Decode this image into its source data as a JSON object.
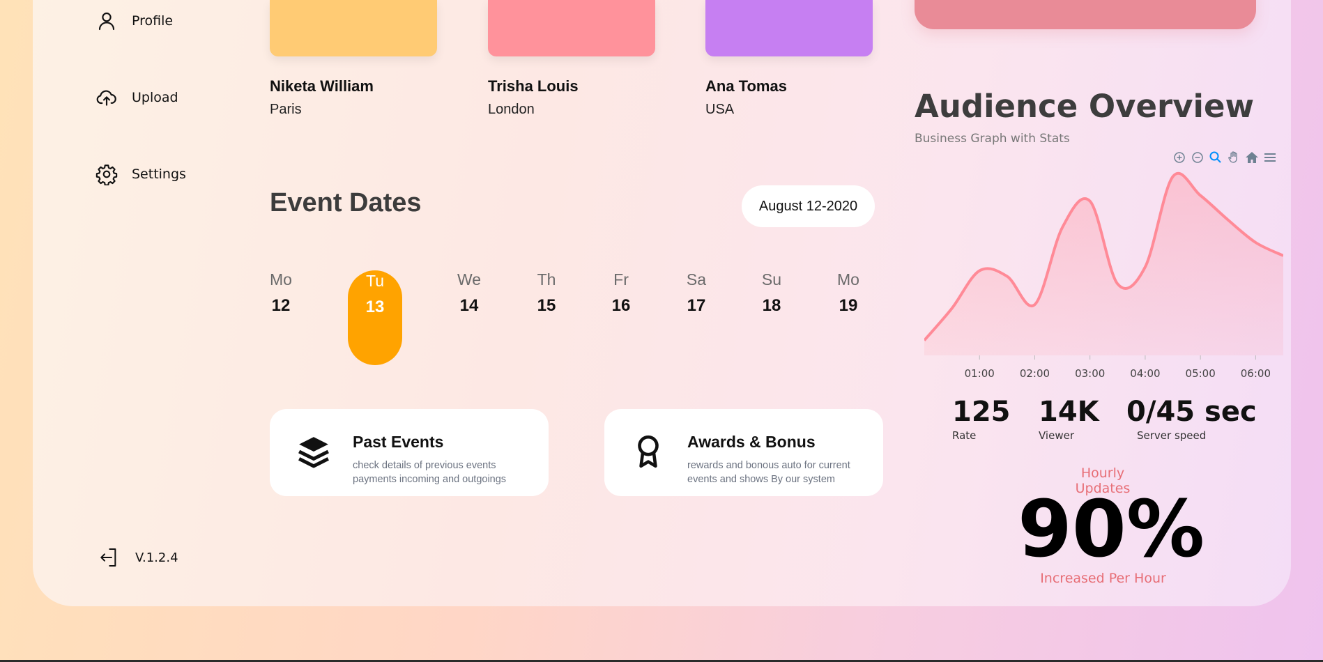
{
  "sidebar": {
    "items": [
      {
        "label": "Profile",
        "icon": "user-icon"
      },
      {
        "label": "Upload",
        "icon": "cloud-upload-icon"
      },
      {
        "label": "Settings",
        "icon": "gear-icon"
      }
    ],
    "version": "V.1.2.4"
  },
  "people": [
    {
      "name": "Niketa William",
      "city": "Paris",
      "color": "#ffcb74"
    },
    {
      "name": "Trisha Louis",
      "city": "London",
      "color": "#ff929b"
    },
    {
      "name": "Ana Tomas",
      "city": "USA",
      "color": "#c67ff2"
    }
  ],
  "events": {
    "title": "Event Dates",
    "selected_date": "August 12-2020",
    "days": [
      {
        "name": "Mo",
        "num": "12"
      },
      {
        "name": "Tu",
        "num": "13",
        "active": true
      },
      {
        "name": "We",
        "num": "14"
      },
      {
        "name": "Th",
        "num": "15"
      },
      {
        "name": "Fr",
        "num": "16"
      },
      {
        "name": "Sa",
        "num": "17"
      },
      {
        "name": "Su",
        "num": "18"
      },
      {
        "name": "Mo",
        "num": "19"
      }
    ],
    "accent": "#ffa300"
  },
  "cards": [
    {
      "title": "Past Events",
      "desc": "check details of previous events payments incoming and outgoings",
      "icon": "layers-icon"
    },
    {
      "title": "Awards & Bonus",
      "desc": "rewards and bonous auto for current events and shows By our system",
      "icon": "award-icon"
    }
  ],
  "audience": {
    "title": "Audience Overview",
    "subtitle": "Business Graph with Stats",
    "toolbar": [
      "zoom-in-icon",
      "zoom-out-icon",
      "zoom-select-icon",
      "pan-hand-icon",
      "home-icon",
      "menu-icon"
    ],
    "stats": [
      {
        "value": "125",
        "label": "Rate"
      },
      {
        "value": "14K",
        "label": "Viewer"
      },
      {
        "value": "0/45 sec",
        "label": "Server speed"
      }
    ],
    "hourly_label": "Hourly Updates",
    "percent": "90%",
    "increase_label": "Increased Per Hour"
  },
  "chart_data": {
    "type": "area",
    "x": [
      "00:00",
      "00:30",
      "01:00",
      "01:30",
      "02:00",
      "02:30",
      "03:00",
      "03:30",
      "04:00",
      "04:30",
      "05:00",
      "05:30",
      "06:00",
      "06:30"
    ],
    "xticks": [
      "01:00",
      "02:00",
      "03:00",
      "04:00",
      "05:00",
      "06:00"
    ],
    "values": [
      8,
      25,
      45,
      42,
      27,
      68,
      82,
      38,
      47,
      95,
      85,
      72,
      60,
      53
    ],
    "ylim": [
      0,
      100
    ],
    "color": "#ff8a97",
    "grid": false,
    "legend": "none"
  }
}
